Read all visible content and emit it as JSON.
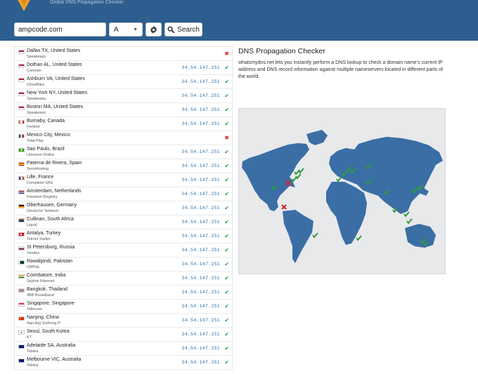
{
  "header": {
    "tagline": "Global DNS Propagation Checker",
    "logo_icon": "warning-triangle-logo",
    "background": "#2d5e8f"
  },
  "search": {
    "domain_value": "ampcode.com",
    "record_type": "A",
    "settings_icon": "gear-icon",
    "search_label": "Search",
    "search_icon": "search-icon"
  },
  "results": [
    {
      "flag": "us",
      "location": "Dallas TX, United States",
      "provider": "Speakeasy",
      "ip": "",
      "status": "fail"
    },
    {
      "flag": "us",
      "location": "Dothan AL, United States",
      "provider": "Comodo",
      "ip": "34.54.147.251",
      "status": "ok"
    },
    {
      "flag": "us",
      "location": "Ashburn VA, United States",
      "provider": "Cloudflare",
      "ip": "34.54.147.251",
      "status": "ok"
    },
    {
      "flag": "us",
      "location": "New York NY, United States",
      "provider": "Speakeasy",
      "ip": "34.54.147.251",
      "status": "ok"
    },
    {
      "flag": "us",
      "location": "Boston MA, United States",
      "provider": "Speakeasy",
      "ip": "34.54.147.251",
      "status": "ok"
    },
    {
      "flag": "ca",
      "location": "Burnaby, Canada",
      "provider": "Fortinet",
      "ip": "34.54.147.251",
      "status": "ok"
    },
    {
      "flag": "mx",
      "location": "Mexico City, Mexico",
      "provider": "Total Play",
      "ip": "",
      "status": "fail"
    },
    {
      "flag": "br",
      "location": "Sao Paulo, Brazil",
      "provider": "Universo Online",
      "ip": "34.54.147.251",
      "status": "ok"
    },
    {
      "flag": "es",
      "location": "Paterna de Rivera, Spain",
      "provider": "ServiHosting",
      "ip": "34.54.147.251",
      "status": "ok"
    },
    {
      "flag": "fr",
      "location": "Lille, France",
      "provider": "Completel SAS",
      "ip": "34.54.147.251",
      "status": "ok"
    },
    {
      "flag": "nl",
      "location": "Amsterdam, Netherlands",
      "provider": "Freedom Registry",
      "ip": "34.54.147.251",
      "status": "ok"
    },
    {
      "flag": "de",
      "location": "Oberhausen, Germany",
      "provider": "Deutsche Telekom",
      "ip": "34.54.147.251",
      "status": "ok"
    },
    {
      "flag": "za",
      "location": "Cullinan, South Africa",
      "provider": "Liquid",
      "ip": "34.54.147.251",
      "status": "ok"
    },
    {
      "flag": "tr",
      "location": "Antalya, Turkey",
      "provider": "Teknet Yazlim",
      "ip": "34.54.147.251",
      "status": "ok"
    },
    {
      "flag": "ru",
      "location": "St Petersburg, Russia",
      "provider": "Yandex",
      "ip": "34.54.147.251",
      "status": "ok"
    },
    {
      "flag": "pk",
      "location": "Rawalpindi, Pakistan",
      "provider": "CMPak",
      "ip": "34.54.147.251",
      "status": "ok"
    },
    {
      "flag": "in",
      "location": "Coimbatore, India",
      "provider": "Skylink Fibernet",
      "ip": "34.54.147.251",
      "status": "ok"
    },
    {
      "flag": "th",
      "location": "Bangkok, Thailand",
      "provider": "3BB Broadband",
      "ip": "34.54.147.251",
      "status": "ok"
    },
    {
      "flag": "sg",
      "location": "Singapore, Singapore",
      "provider": "Tefincom",
      "ip": "34.54.147.251",
      "status": "ok"
    },
    {
      "flag": "cn",
      "location": "Nanjing, China",
      "provider": "NanJing XinFeng IT",
      "ip": "34.54.147.251",
      "status": "ok"
    },
    {
      "flag": "kr",
      "location": "Seoul, South Korea",
      "provider": "KT",
      "ip": "34.54.147.251",
      "status": "ok"
    },
    {
      "flag": "au",
      "location": "Adelaide SA, Australia",
      "provider": "Telstra",
      "ip": "34.54.147.251",
      "status": "ok"
    },
    {
      "flag": "au",
      "location": "Melbourne VIC, Australia",
      "provider": "Telstra",
      "ip": "34.54.147.251",
      "status": "ok"
    }
  ],
  "info": {
    "title": "DNS Propagation Checker",
    "description": "whatsmydns.net lets you instantly perform a DNS lookup to check a domain name's current IP address and DNS record information against multiple nameservers located in different parts of the world."
  },
  "map": {
    "land_color": "#3a6ea5",
    "ok_color": "#2e9b3e",
    "fail_color": "#d62a2a"
  }
}
